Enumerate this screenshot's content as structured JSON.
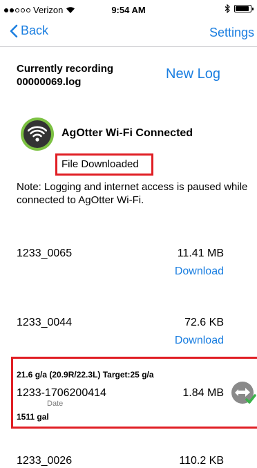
{
  "status_bar": {
    "carrier": "Verizon",
    "time": "9:54 AM"
  },
  "nav": {
    "back_label": "Back",
    "settings_label": "Settings"
  },
  "recording": {
    "label_line1": "Currently recording",
    "label_line2": "00000069.log",
    "new_log_label": "New Log"
  },
  "wifi": {
    "title": "AgOtter Wi-Fi Connected",
    "status": "File Downloaded",
    "note": "Note: Logging and internet access is paused while connected to AgOtter Wi-Fi."
  },
  "files": [
    {
      "name": "1233_0065",
      "size": "11.41 MB",
      "action": "Download"
    },
    {
      "name": "1233_0044",
      "size": "72.6 KB",
      "action": "Download"
    },
    {
      "name": "1233-1706200414",
      "size": "1.84 MB",
      "target_info": "21.6 g/a (20.9R/22.3L) Target:25 g/a",
      "date_label": "Date",
      "gallons": "1511 gal"
    },
    {
      "name": "1233_0026",
      "size": "110.2 KB"
    }
  ],
  "colors": {
    "accent": "#1a7ee0",
    "highlight": "#e01e24",
    "wifi_ring": "#7cc142",
    "check": "#3bb34a"
  }
}
